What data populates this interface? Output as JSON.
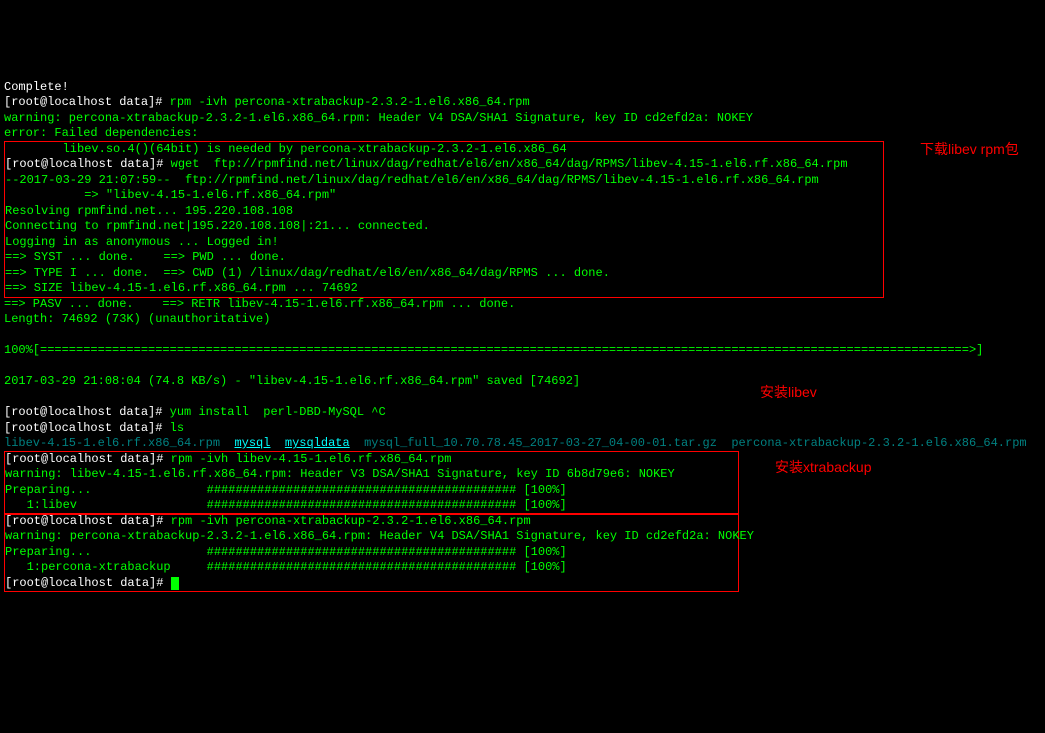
{
  "terminal": {
    "complete": "Complete!",
    "prompt1_u": "[root@localhost data]#",
    "prompt1_cmd": " rpm -ivh percona-xtrabackup-2.3.2-1.el6.x86_64.rpm",
    "warning1": "warning: percona-xtrabackup-2.3.2-1.el6.x86_64.rpm: Header V4 DSA/SHA1 Signature, key ID cd2efd2a: NOKEY",
    "error_failed": "error: Failed dependencies:",
    "dep_line": "        libev.so.4()(64bit) is needed by percona-xtrabackup-2.3.2-1.el6.x86_64",
    "prompt2_u": "[root@localhost data]#",
    "prompt2_cmd": " wget  ftp://rpmfind.net/linux/dag/redhat/el6/en/x86_64/dag/RPMS/libev-4.15-1.el6.rf.x86_64.rpm",
    "ts": "--2017-03-29 21:07:59--  ftp://rpmfind.net/linux/dag/redhat/el6/en/x86_64/dag/RPMS/libev-4.15-1.el6.rf.x86_64.rpm",
    "arrow": "           => \"libev-4.15-1.el6.rf.x86_64.rpm\"",
    "resolve": "Resolving rpmfind.net... 195.220.108.108",
    "connect": "Connecting to rpmfind.net|195.220.108.108|:21... connected.",
    "login": "Logging in as anonymous ... Logged in!",
    "syst": "==> SYST ... done.    ==> PWD ... done.",
    "type": "==> TYPE I ... done.  ==> CWD (1) /linux/dag/redhat/el6/en/x86_64/dag/RPMS ... done.",
    "size": "==> SIZE libev-4.15-1.el6.rf.x86_64.rpm ... 74692",
    "pasv": "==> PASV ... done.    ==> RETR libev-4.15-1.el6.rf.x86_64.rpm ... done.",
    "length": "Length: 74692 (73K) (unauthoritative)",
    "progress": "100%[=================================================================================================================================>]",
    "saved": "2017-03-29 21:08:04 (74.8 KB/s) - \"libev-4.15-1.el6.rf.x86_64.rpm\" saved [74692]",
    "prompt3_u": "[root@localhost data]#",
    "prompt3_cmd": " yum install  perl-DBD-MySQL ^C",
    "prompt4_u": "[root@localhost data]#",
    "prompt4_cmd": " ls",
    "ls_file1": "libev-4.15-1.el6.rf.x86_64.rpm",
    "ls_dir1": "mysql",
    "ls_dir2": "mysqldata",
    "ls_file2": "mysql_full_10.70.78.45_2017-03-27_04-00-01.tar.gz",
    "ls_file3": "percona-xtrabackup-2.3.2-1.el6.x86_64.rpm",
    "prompt5_u": "[root@localhost data]#",
    "prompt5_cmd": " rpm -ivh libev-4.15-1.el6.rf.x86_64.rpm",
    "warning2": "warning: libev-4.15-1.el6.rf.x86_64.rpm: Header V3 DSA/SHA1 Signature, key ID 6b8d79e6: NOKEY",
    "preparing1": "Preparing...                ########################################### [100%]",
    "pkg_libev": "   1:libev                  ########################################### [100%]",
    "prompt6_u": "[root@localhost data]#",
    "prompt6_cmd": " rpm -ivh percona-xtrabackup-2.3.2-1.el6.x86_64.rpm",
    "warning3": "warning: percona-xtrabackup-2.3.2-1.el6.x86_64.rpm: Header V4 DSA/SHA1 Signature, key ID cd2efd2a: NOKEY",
    "preparing2": "Preparing...                ########################################### [100%]",
    "pkg_xtra": "   1:percona-xtrabackup     ########################################### [100%]",
    "prompt7_u": "[root@localhost data]#",
    "prompt7_cmd": " "
  },
  "annotations": {
    "a1": "下载libev rpm包",
    "a2": "安装libev",
    "a3": "安装xtrabackup"
  }
}
